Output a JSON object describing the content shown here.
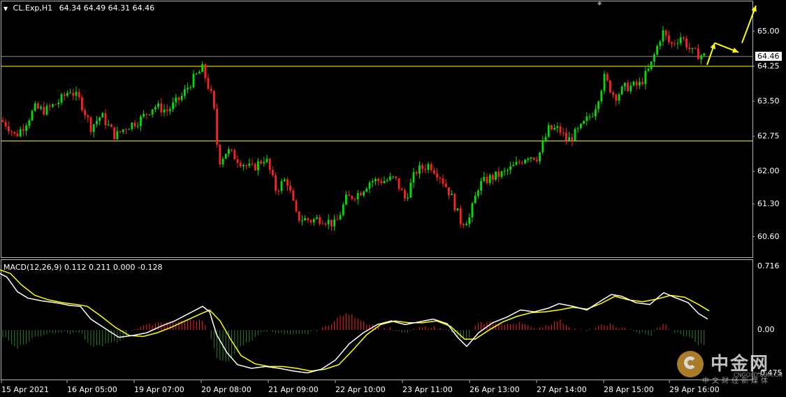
{
  "header": {
    "symbol": "CL.Exp,H1",
    "ohlc": "64.34 64.49 64.31 64.46"
  },
  "macd_header": "MACD(12,26,9) 0.112 0.211 0.000 -0.128",
  "current_price": "64.46",
  "colors": {
    "background": "#000000",
    "bull": "#00e000",
    "bear": "#ff2020",
    "level_line": "#ffff00",
    "macd_main": "#ffffff",
    "macd_signal": "#ffff00",
    "arrow": "#ffff00",
    "hist_up": "#ff2020",
    "hist_down": "#2e7d2e"
  },
  "chart_data": [
    {
      "type": "candlestick",
      "title": "CL.Exp,H1",
      "price_axis_ticks": [
        65.0,
        64.25,
        63.5,
        62.75,
        62.0,
        61.3,
        60.6
      ],
      "price_axis_labels": [
        "65.00",
        "64.25",
        "63.50",
        "62.75",
        "62.00",
        "61.30",
        "60.60"
      ],
      "ylim": [
        60.25,
        65.55
      ],
      "time_axis_labels": [
        "15 Apr 2021",
        "16 Apr 05:00",
        "19 Apr 07:00",
        "20 Apr 08:00",
        "21 Apr 09:00",
        "22 Apr 10:00",
        "23 Apr 11:00",
        "26 Apr 13:00",
        "27 Apr 14:00",
        "28 Apr 15:00",
        "29 Apr 16:00"
      ],
      "horizontal_levels": [
        64.25,
        62.65
      ],
      "current_price": 64.46,
      "close_path": [
        {
          "x": 0,
          "close": 63.1
        },
        {
          "x": 10,
          "close": 63.0
        },
        {
          "x": 22,
          "close": 62.75
        },
        {
          "x": 35,
          "close": 63.0
        },
        {
          "x": 50,
          "close": 63.35
        },
        {
          "x": 65,
          "close": 63.3
        },
        {
          "x": 85,
          "close": 63.5
        },
        {
          "x": 100,
          "close": 63.75
        },
        {
          "x": 115,
          "close": 63.5
        },
        {
          "x": 130,
          "close": 62.95
        },
        {
          "x": 145,
          "close": 63.2
        },
        {
          "x": 165,
          "close": 62.75
        },
        {
          "x": 180,
          "close": 62.95
        },
        {
          "x": 200,
          "close": 63.1
        },
        {
          "x": 220,
          "close": 63.4
        },
        {
          "x": 240,
          "close": 63.3
        },
        {
          "x": 260,
          "close": 63.6
        },
        {
          "x": 275,
          "close": 63.95
        },
        {
          "x": 290,
          "close": 64.2
        },
        {
          "x": 305,
          "close": 63.5
        },
        {
          "x": 313,
          "close": 62.2
        },
        {
          "x": 325,
          "close": 62.45
        },
        {
          "x": 345,
          "close": 62.2
        },
        {
          "x": 360,
          "close": 62.05
        },
        {
          "x": 380,
          "close": 62.3
        },
        {
          "x": 395,
          "close": 61.6
        },
        {
          "x": 410,
          "close": 61.85
        },
        {
          "x": 425,
          "close": 61.0
        },
        {
          "x": 445,
          "close": 60.95
        },
        {
          "x": 460,
          "close": 61.0
        },
        {
          "x": 480,
          "close": 60.85
        },
        {
          "x": 495,
          "close": 61.4
        },
        {
          "x": 515,
          "close": 61.55
        },
        {
          "x": 530,
          "close": 61.8
        },
        {
          "x": 550,
          "close": 61.8
        },
        {
          "x": 565,
          "close": 61.85
        },
        {
          "x": 580,
          "close": 61.4
        },
        {
          "x": 595,
          "close": 62.0
        },
        {
          "x": 615,
          "close": 62.15
        },
        {
          "x": 630,
          "close": 61.9
        },
        {
          "x": 645,
          "close": 61.5
        },
        {
          "x": 660,
          "close": 60.9
        },
        {
          "x": 672,
          "close": 61.0
        },
        {
          "x": 685,
          "close": 61.7
        },
        {
          "x": 700,
          "close": 61.85
        },
        {
          "x": 720,
          "close": 61.95
        },
        {
          "x": 740,
          "close": 62.15
        },
        {
          "x": 755,
          "close": 62.35
        },
        {
          "x": 770,
          "close": 62.3
        },
        {
          "x": 785,
          "close": 62.9
        },
        {
          "x": 800,
          "close": 62.9
        },
        {
          "x": 812,
          "close": 62.65
        },
        {
          "x": 830,
          "close": 62.9
        },
        {
          "x": 850,
          "close": 63.3
        },
        {
          "x": 865,
          "close": 64.0
        },
        {
          "x": 880,
          "close": 63.6
        },
        {
          "x": 895,
          "close": 63.8
        },
        {
          "x": 915,
          "close": 63.85
        },
        {
          "x": 930,
          "close": 64.2
        },
        {
          "x": 948,
          "close": 65.0
        },
        {
          "x": 960,
          "close": 64.7
        },
        {
          "x": 975,
          "close": 64.9
        },
        {
          "x": 990,
          "close": 64.55
        },
        {
          "x": 1010,
          "close": 64.46
        }
      ],
      "annotation_arrows": [
        {
          "from": [
            1012,
            64.28
          ],
          "to": [
            1023,
            64.75
          ]
        },
        {
          "from": [
            1023,
            64.75
          ],
          "to": [
            1057,
            64.55
          ]
        },
        {
          "from": [
            1062,
            64.75
          ],
          "to": [
            1082,
            65.55
          ]
        }
      ]
    },
    {
      "type": "macd",
      "title": "MACD(12,26,9)",
      "params": [
        12,
        26,
        9
      ],
      "values": {
        "main": 0.112,
        "signal": 0.211,
        "hist": 0.0,
        "extra": -0.128
      },
      "axis_ticks": [
        0.716,
        0.0,
        -0.475
      ],
      "axis_labels": [
        "0.716",
        "0.00",
        "-0.475"
      ],
      "ylim": [
        -0.52,
        0.73
      ],
      "main_line": [
        [
          0,
          0.62
        ],
        [
          10,
          0.58
        ],
        [
          25,
          0.42
        ],
        [
          40,
          0.35
        ],
        [
          60,
          0.32
        ],
        [
          80,
          0.3
        ],
        [
          100,
          0.27
        ],
        [
          115,
          0.26
        ],
        [
          130,
          0.12
        ],
        [
          150,
          0.02
        ],
        [
          170,
          -0.08
        ],
        [
          190,
          -0.06
        ],
        [
          210,
          -0.03
        ],
        [
          230,
          0.04
        ],
        [
          250,
          0.1
        ],
        [
          270,
          0.18
        ],
        [
          290,
          0.26
        ],
        [
          300,
          0.2
        ],
        [
          310,
          -0.05
        ],
        [
          325,
          -0.25
        ],
        [
          340,
          -0.38
        ],
        [
          360,
          -0.42
        ],
        [
          380,
          -0.4
        ],
        [
          400,
          -0.42
        ],
        [
          420,
          -0.45
        ],
        [
          440,
          -0.47
        ],
        [
          460,
          -0.43
        ],
        [
          480,
          -0.33
        ],
        [
          500,
          -0.15
        ],
        [
          520,
          -0.03
        ],
        [
          540,
          0.06
        ],
        [
          560,
          0.1
        ],
        [
          580,
          0.06
        ],
        [
          600,
          0.09
        ],
        [
          620,
          0.12
        ],
        [
          640,
          0.07
        ],
        [
          655,
          -0.08
        ],
        [
          668,
          -0.18
        ],
        [
          685,
          -0.03
        ],
        [
          705,
          0.08
        ],
        [
          725,
          0.14
        ],
        [
          745,
          0.22
        ],
        [
          765,
          0.2
        ],
        [
          785,
          0.24
        ],
        [
          800,
          0.29
        ],
        [
          820,
          0.26
        ],
        [
          840,
          0.22
        ],
        [
          860,
          0.32
        ],
        [
          875,
          0.39
        ],
        [
          890,
          0.37
        ],
        [
          910,
          0.3
        ],
        [
          930,
          0.28
        ],
        [
          950,
          0.41
        ],
        [
          965,
          0.36
        ],
        [
          985,
          0.3
        ],
        [
          1000,
          0.18
        ],
        [
          1013,
          0.12
        ]
      ],
      "signal_line": [
        [
          0,
          0.66
        ],
        [
          15,
          0.62
        ],
        [
          30,
          0.5
        ],
        [
          50,
          0.38
        ],
        [
          70,
          0.33
        ],
        [
          90,
          0.3
        ],
        [
          110,
          0.28
        ],
        [
          125,
          0.26
        ],
        [
          145,
          0.15
        ],
        [
          165,
          0.03
        ],
        [
          185,
          -0.06
        ],
        [
          205,
          -0.07
        ],
        [
          225,
          -0.03
        ],
        [
          245,
          0.03
        ],
        [
          265,
          0.1
        ],
        [
          285,
          0.17
        ],
        [
          300,
          0.22
        ],
        [
          315,
          0.1
        ],
        [
          330,
          -0.1
        ],
        [
          345,
          -0.28
        ],
        [
          365,
          -0.37
        ],
        [
          385,
          -0.4
        ],
        [
          405,
          -0.4
        ],
        [
          425,
          -0.42
        ],
        [
          445,
          -0.45
        ],
        [
          465,
          -0.43
        ],
        [
          485,
          -0.38
        ],
        [
          505,
          -0.22
        ],
        [
          525,
          -0.05
        ],
        [
          545,
          0.06
        ],
        [
          565,
          0.1
        ],
        [
          585,
          0.08
        ],
        [
          605,
          0.08
        ],
        [
          625,
          0.1
        ],
        [
          645,
          0.04
        ],
        [
          665,
          -0.1
        ],
        [
          680,
          -0.1
        ],
        [
          700,
          0.0
        ],
        [
          720,
          0.09
        ],
        [
          740,
          0.15
        ],
        [
          760,
          0.19
        ],
        [
          780,
          0.2
        ],
        [
          800,
          0.22
        ],
        [
          820,
          0.25
        ],
        [
          840,
          0.23
        ],
        [
          860,
          0.29
        ],
        [
          880,
          0.37
        ],
        [
          900,
          0.33
        ],
        [
          920,
          0.31
        ],
        [
          940,
          0.34
        ],
        [
          960,
          0.38
        ],
        [
          980,
          0.36
        ],
        [
          1000,
          0.28
        ],
        [
          1015,
          0.21
        ]
      ]
    }
  ],
  "watermark": {
    "name": "中金网",
    "sub": "中文财经新媒体",
    "domain": "CNGOLD.COM.CN"
  }
}
